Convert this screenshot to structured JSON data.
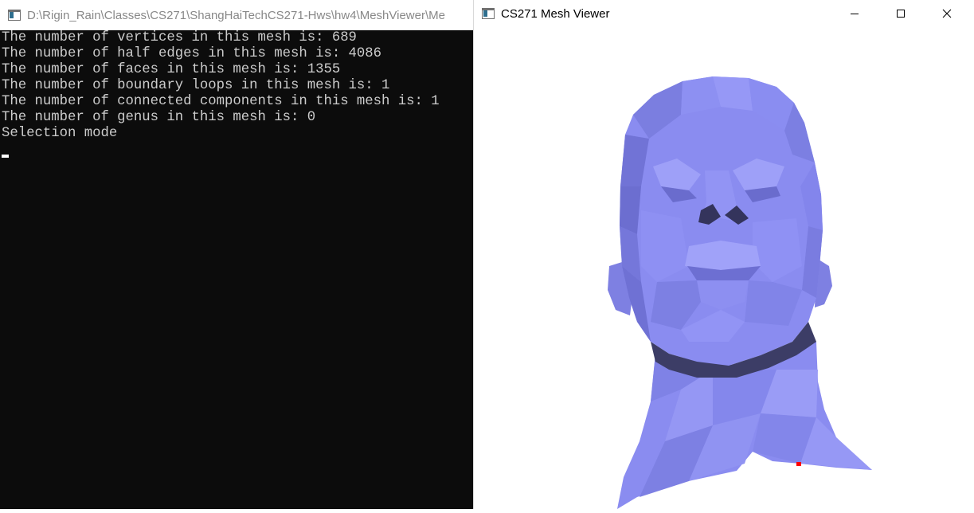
{
  "console": {
    "title": "D:\\Rigin_Rain\\Classes\\CS271\\ShangHaiTechCS271-Hws\\hw4\\MeshViewer\\Me",
    "lines": [
      "The number of vertices in this mesh is: 689",
      "The number of half edges in this mesh is: 4086",
      "The number of faces in this mesh is: 1355",
      "The number of boundary loops in this mesh is: 1",
      "The number of connected components in this mesh is: 1",
      "The number of genus in this mesh is: 0",
      "Selection mode"
    ],
    "icon": "console-app-icon"
  },
  "viewer": {
    "title": "CS271 Mesh Viewer",
    "icon": "opengl-app-icon",
    "controls": [
      "minimize-icon",
      "maximize-icon",
      "close-icon"
    ],
    "mesh_color": "#8a8cf0",
    "selected_vertex_color": "#ff0000"
  }
}
